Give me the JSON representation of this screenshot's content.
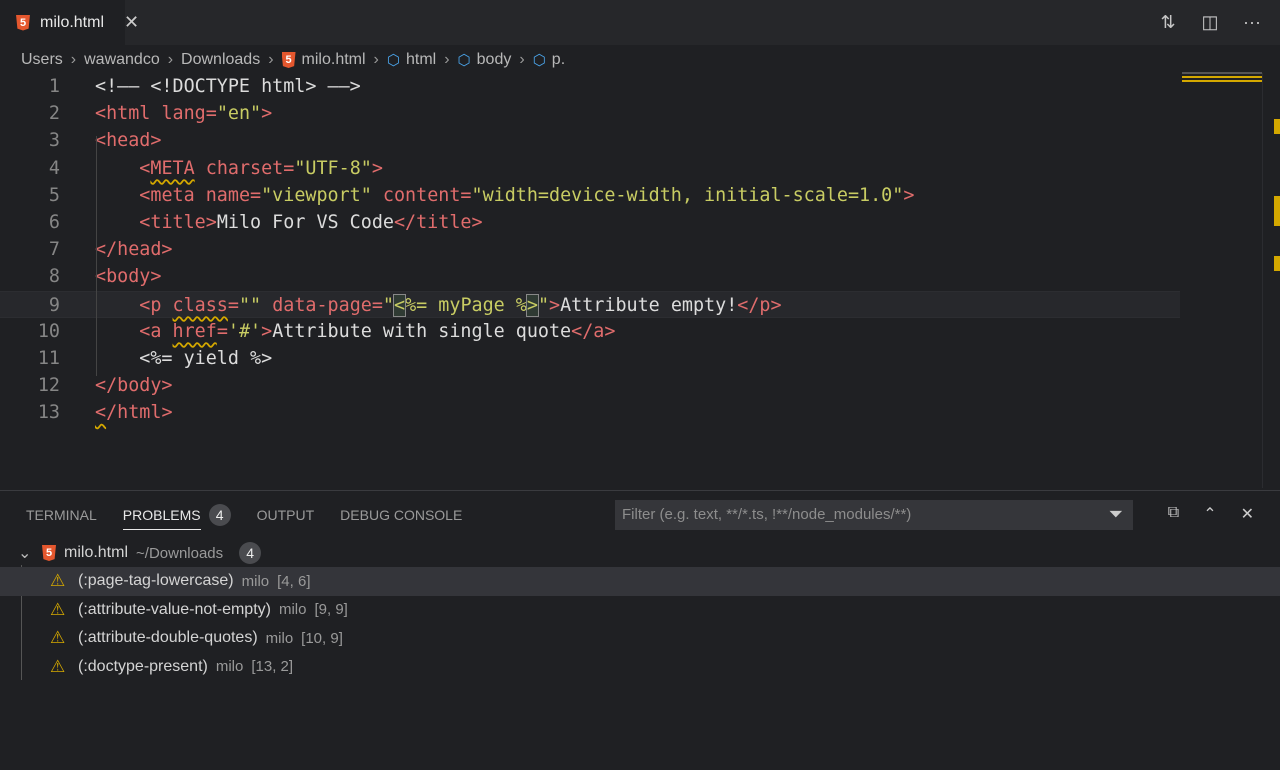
{
  "tab": {
    "title": "milo.html",
    "icon": "html5-icon"
  },
  "actions": [
    "source-control-compare-icon",
    "split-editor-icon",
    "more-icon"
  ],
  "breadcrumb": [
    "Users",
    "wawandco",
    "Downloads",
    "milo.html",
    "html",
    "body",
    "p."
  ],
  "code": [
    [
      [
        "x",
        "<!—— <!DOCTYPE html> ——>"
      ]
    ],
    [
      [
        "t",
        "<html "
      ],
      [
        "a",
        "lang="
      ],
      [
        "s",
        "\"en\""
      ],
      [
        "t",
        ">"
      ]
    ],
    [
      [
        "t",
        "<head>"
      ]
    ],
    [
      [
        "x",
        "    "
      ],
      [
        "t",
        "<"
      ],
      [
        "tq",
        "META"
      ],
      [
        "a",
        " charset="
      ],
      [
        "s",
        "\"UTF-8\""
      ],
      [
        "t",
        ">"
      ]
    ],
    [
      [
        "x",
        "    "
      ],
      [
        "t",
        "<meta "
      ],
      [
        "a",
        "name="
      ],
      [
        "s",
        "\"viewport\""
      ],
      [
        "a",
        " content="
      ],
      [
        "s",
        "\"width=device-width, initial-scale=1.0\""
      ],
      [
        "t",
        ">"
      ]
    ],
    [
      [
        "x",
        "    "
      ],
      [
        "t",
        "<title>"
      ],
      [
        "x",
        "Milo For VS Code"
      ],
      [
        "t",
        "</title>"
      ]
    ],
    [
      [
        "t",
        "</head>"
      ]
    ],
    [
      [
        "t",
        "<body>"
      ]
    ],
    [
      [
        "x",
        "    "
      ],
      [
        "t",
        "<p "
      ],
      [
        "aq",
        "class"
      ],
      [
        "a",
        "="
      ],
      [
        "s",
        "\"\""
      ],
      [
        "a",
        " data-page="
      ],
      [
        "s",
        "\""
      ],
      [
        "sb",
        "<"
      ],
      [
        "s",
        "%= myPage %"
      ],
      [
        "sb",
        ">"
      ],
      [
        "s",
        "\""
      ],
      [
        "t",
        ">"
      ],
      [
        "x",
        "Attribute empty!"
      ],
      [
        "t",
        "</p>"
      ]
    ],
    [
      [
        "x",
        "    "
      ],
      [
        "t",
        "<a "
      ],
      [
        "aq",
        "href"
      ],
      [
        "a",
        "="
      ],
      [
        "s",
        "'#'"
      ],
      [
        "t",
        ">"
      ],
      [
        "x",
        "Attribute with single quote"
      ],
      [
        "t",
        "</a>"
      ]
    ],
    [
      [
        "x",
        "    <%= yield %>"
      ]
    ],
    [
      [
        "t",
        "</body>"
      ]
    ],
    [
      [
        "tq",
        "<"
      ],
      [
        "t",
        "/html>"
      ]
    ]
  ],
  "current_line": 9,
  "panel": {
    "tabs": [
      {
        "label": "TERMINAL"
      },
      {
        "label": "PROBLEMS",
        "badge": "4",
        "active": true
      },
      {
        "label": "OUTPUT"
      },
      {
        "label": "DEBUG CONSOLE"
      }
    ],
    "filter_placeholder": "Filter (e.g. text, **/*.ts, !**/node_modules/**)",
    "file": {
      "name": "milo.html",
      "path": "~/Downloads",
      "count": "4"
    },
    "problems": [
      {
        "code": "(:page-tag-lowercase)",
        "source": "milo",
        "pos": "[4, 6]"
      },
      {
        "code": "(:attribute-value-not-empty)",
        "source": "milo",
        "pos": "[9, 9]"
      },
      {
        "code": "(:attribute-double-quotes)",
        "source": "milo",
        "pos": "[10, 9]"
      },
      {
        "code": "(:doctype-present)",
        "source": "milo",
        "pos": "[13, 2]"
      }
    ]
  },
  "colors": {
    "warning": "#d4a800",
    "tag": "#e06c6c",
    "string": "#c8cc63",
    "html5": "#e4572e",
    "accent": "#4aa3e8"
  }
}
